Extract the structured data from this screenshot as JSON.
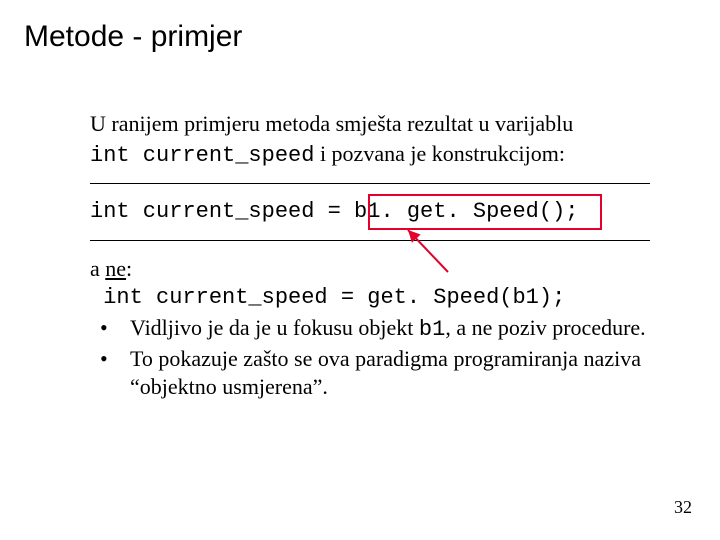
{
  "title": "Metode - primjer",
  "intro": {
    "line1": "U ranijem primjeru metoda smješta rezultat u varijablu",
    "line2_code": "int current_speed",
    "line2_tail": " i pozvana je konstrukcijom:"
  },
  "code_ok": "int current_speed = b1. get. Speed();",
  "ane": {
    "label": "a ne:",
    "code": " int current_speed = get. Speed(b1);"
  },
  "bullets": [
    {
      "pre": "Vidljivo je da je u fokusu objekt ",
      "code": "b1",
      "post": ", a ne poziv procedure."
    },
    {
      "pre": "To pokazuje zašto se ova paradigma programiranja naziva “objektno usmjerena”.",
      "code": "",
      "post": ""
    }
  ],
  "page_number": "32"
}
